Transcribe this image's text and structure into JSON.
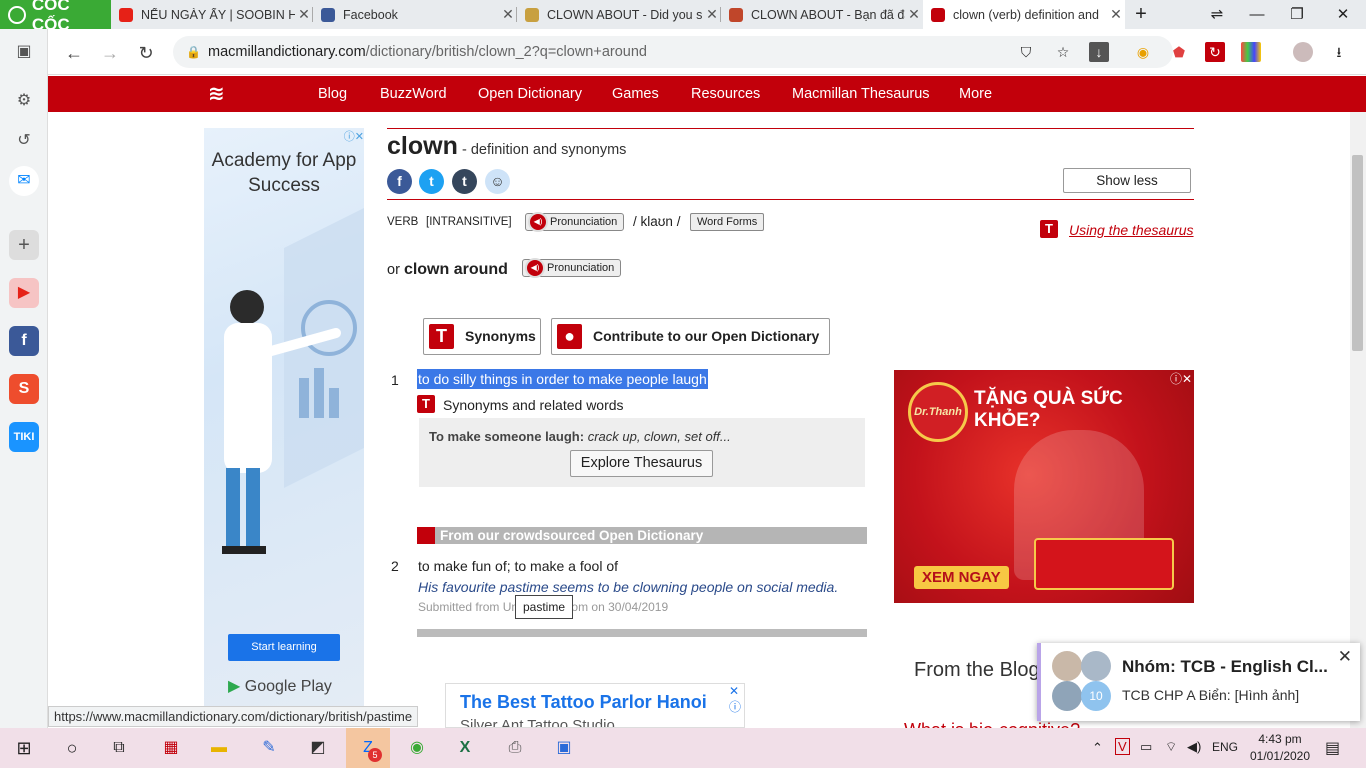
{
  "browser": {
    "brand": "CỐC CỐC",
    "tabs": [
      {
        "title": "NẾU NGÀY ẤY | SOOBIN HO",
        "icon": "youtube-icon",
        "color": "#e62117"
      },
      {
        "title": "Facebook",
        "icon": "facebook-icon",
        "color": "#3b5998"
      },
      {
        "title": "CLOWN ABOUT - Did you s",
        "icon": "puzzle-icon",
        "color": "#c8a040"
      },
      {
        "title": "CLOWN ABOUT - Bạn đã đă",
        "icon": "shield-crest-icon",
        "color": "#c0462a"
      },
      {
        "title": "clown (verb) definition and",
        "icon": "macmillan-icon",
        "color": "#c2000b"
      }
    ],
    "new_tab": "+",
    "url_host": "macmillandictionary.com",
    "url_path": "/dictionary/british/clown_2?q=clown+around",
    "status_url": "https://www.macmillandictionary.com/dictionary/british/pastime"
  },
  "site_nav": {
    "items": [
      "Blog",
      "BuzzWord",
      "Open Dictionary",
      "Games",
      "Resources",
      "Macmillan Thesaurus",
      "More"
    ]
  },
  "entry": {
    "headword": "clown",
    "subtitle": " - definition and synonyms",
    "show_less": "Show less",
    "pos": "VERB",
    "grammar": "[INTRANSITIVE]",
    "pronunciation_label": "Pronunciation",
    "ipa": "/ klaʊn /",
    "word_forms": "Word Forms",
    "using_thesaurus": "Using the thesaurus",
    "or_text": "or",
    "phrasal": "clown around",
    "synonyms_btn": "Synonyms",
    "contribute_btn": "Contribute to our Open Dictionary",
    "sense1_num": "1",
    "sense1_def": "to do silly things in order to make people laugh",
    "syn_related": "Synonyms and related words",
    "syn_lead": "To make someone laugh:",
    "syn_list": " crack up, clown, set off...",
    "explore": "Explore Thesaurus",
    "crowd_heading": "From our crowdsourced Open Dictionary",
    "sense2_num": "2",
    "sense2_def": "to make fun of; to make a fool of",
    "sense2_example": "His favourite pastime seems to be clowning people on social media.",
    "submitted": "Submitted from United Kingdom on 30/04/2019",
    "tooltip": "pastime"
  },
  "ads": {
    "left_title": "Academy for App Success",
    "left_button": "Start learning",
    "left_store": "Google Play",
    "right_headline": "TẶNG QUÀ SỨC KHỎE?",
    "right_brand": "Dr.Thanh",
    "right_cta": "XEM NGAY",
    "bottom_title": "The Best Tattoo Parlor Hanoi",
    "bottom_sub": "Silver Ant Tattoo Studio"
  },
  "blog": {
    "heading": "From the Blog",
    "teaser": "What is bio-cognitive?"
  },
  "notification": {
    "title": "Nhóm: TCB - English Cl...",
    "message": "TCB CHP A Biển: [Hình ảnh]",
    "badge": "10"
  },
  "taskbar": {
    "time": "4:43 pm",
    "date": "01/01/2020",
    "lang": "ENG",
    "zalo_badge": "5"
  }
}
